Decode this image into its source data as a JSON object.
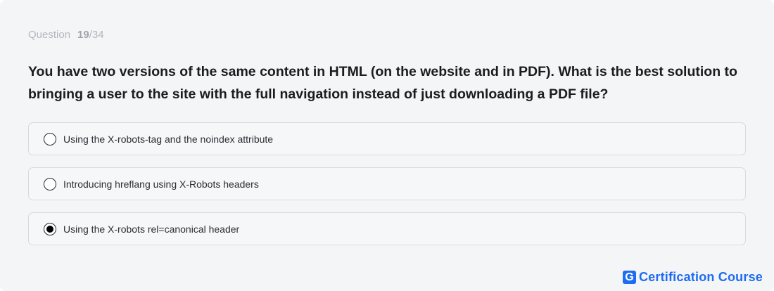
{
  "question": {
    "counter_label": "Question",
    "current": "19",
    "total": "/34",
    "text": "You have two versions of the same content in HTML (on the website and in PDF). What is the best solution to bringing a user to the site with the full navigation instead of just downloading a PDF file?"
  },
  "options": [
    {
      "label": "Using the X-robots-tag and the noindex attribute",
      "selected": false
    },
    {
      "label": "Introducing hreflang using X-Robots headers",
      "selected": false
    },
    {
      "label": "Using the X-robots rel=canonical header",
      "selected": true
    }
  ],
  "brand": {
    "logo_letter": "G",
    "text": "Certification Course",
    "color": "#1e6cf2"
  }
}
